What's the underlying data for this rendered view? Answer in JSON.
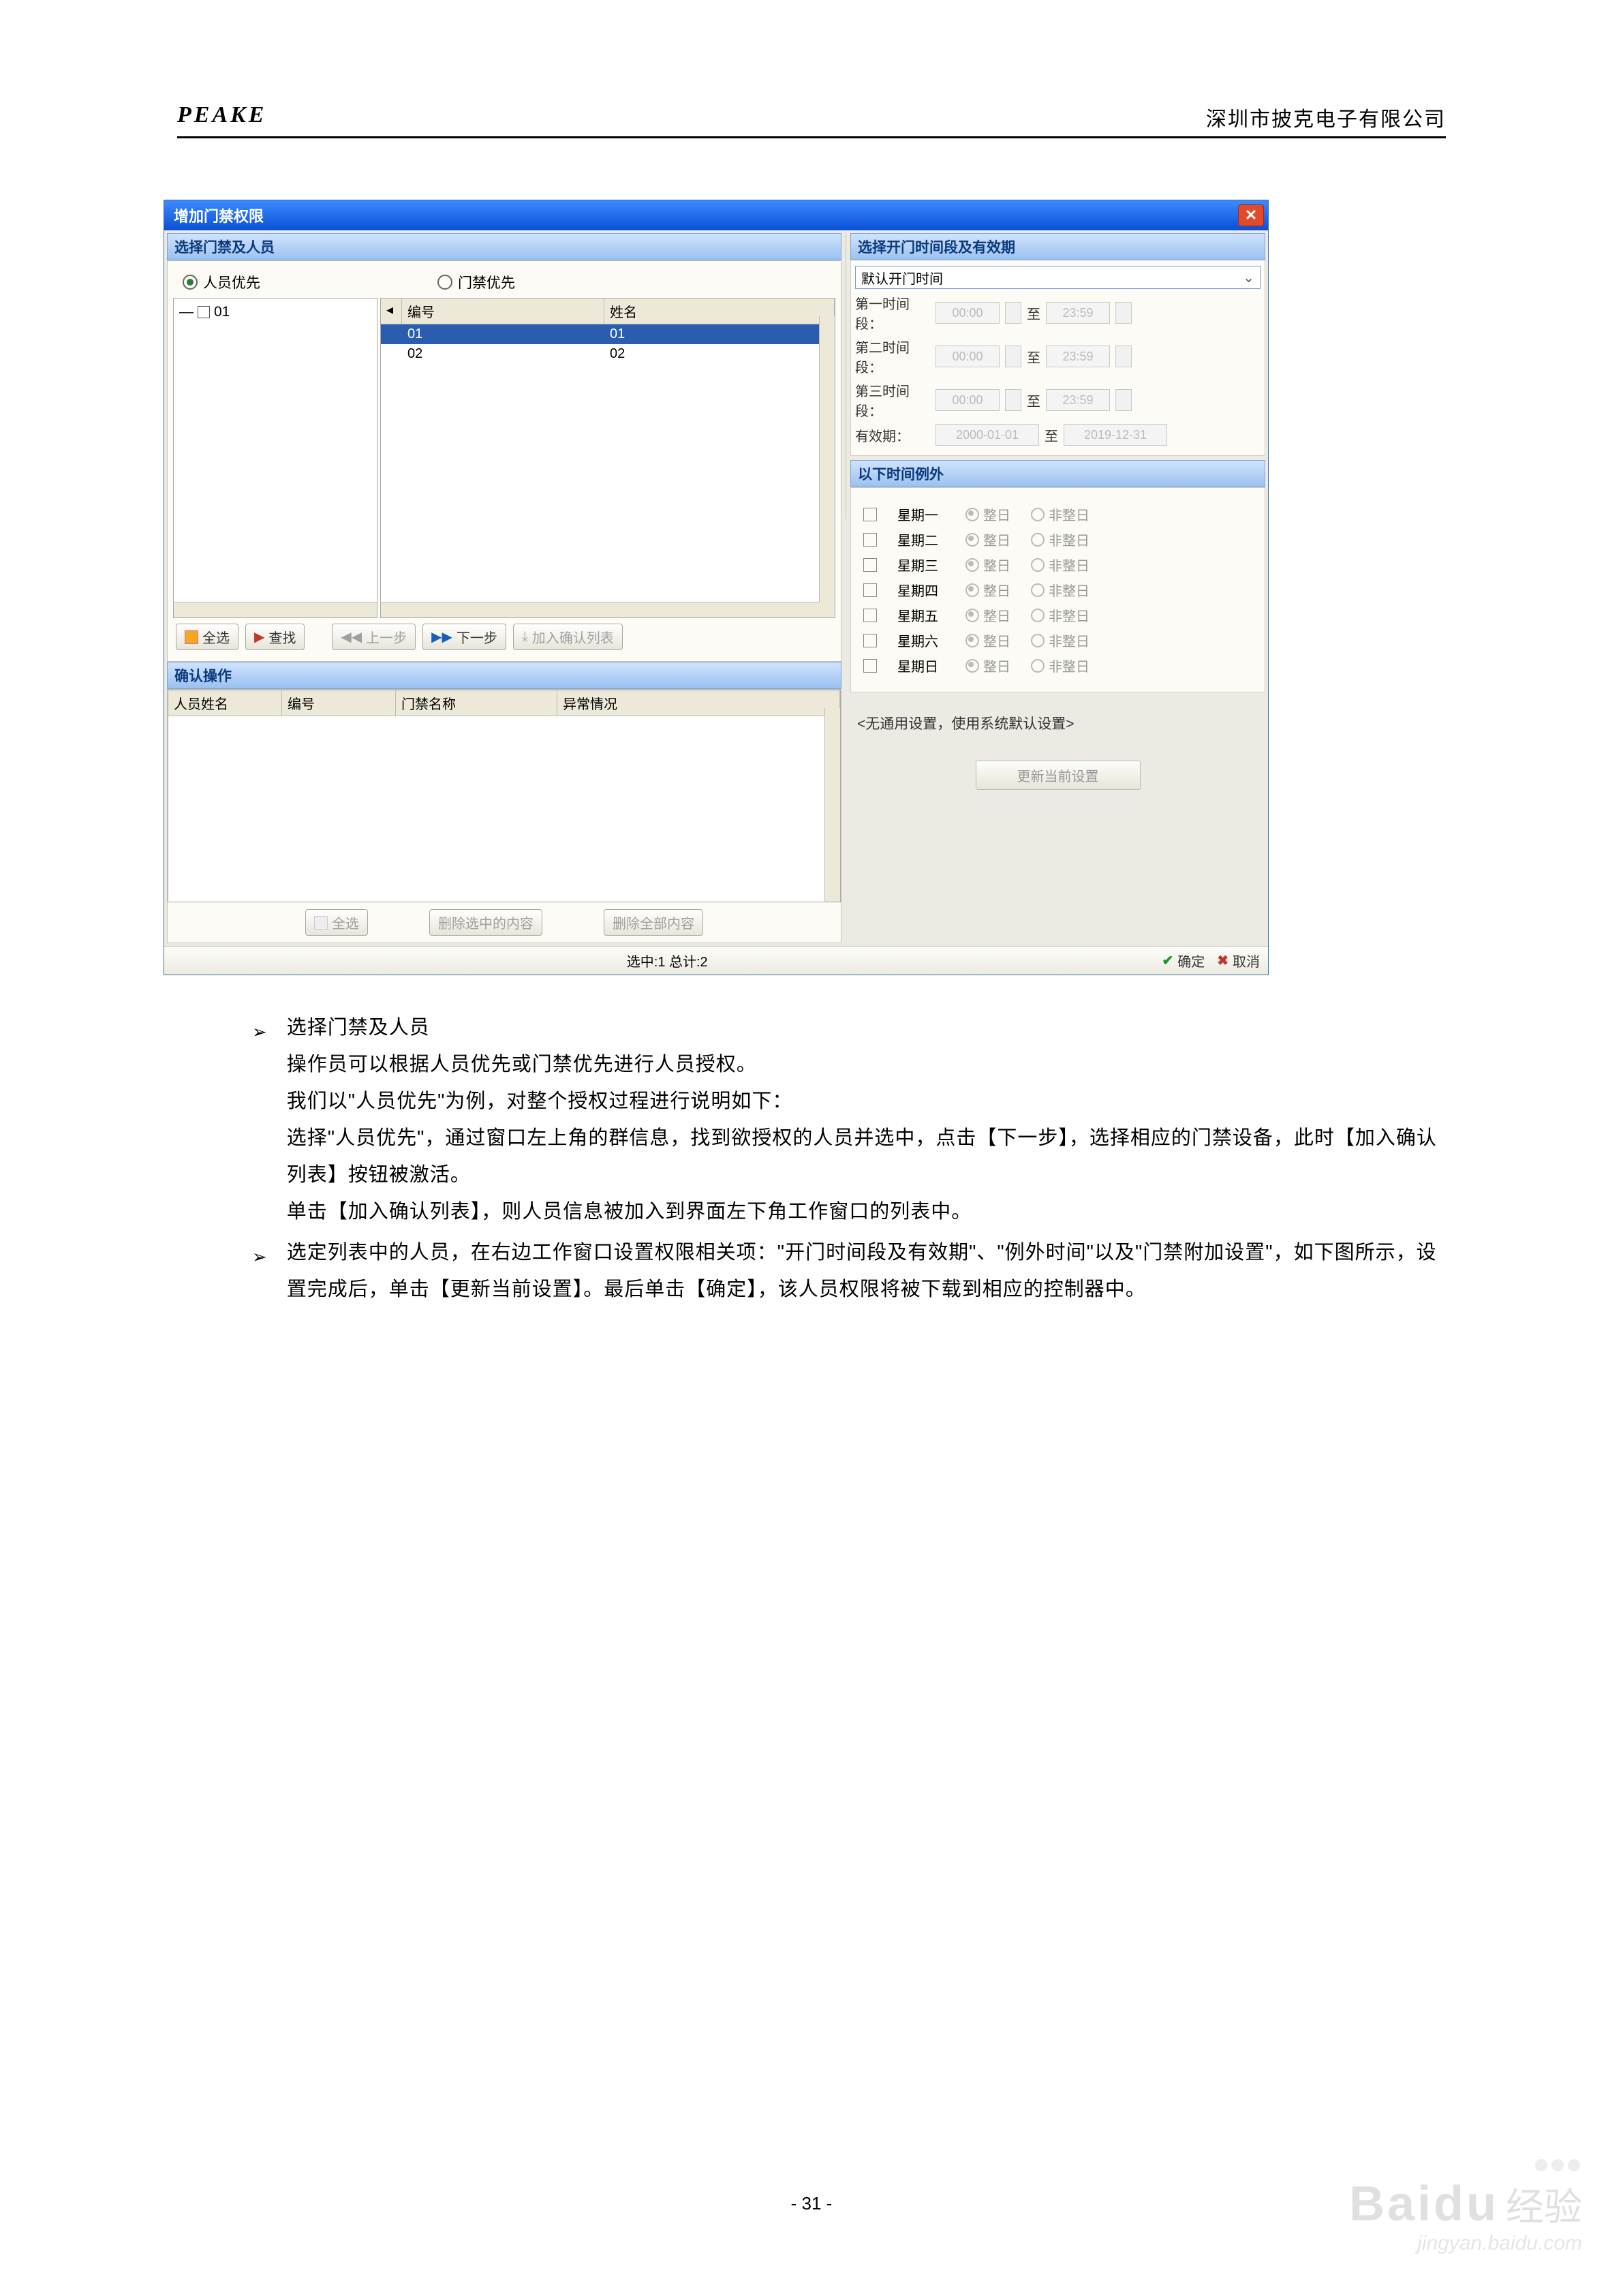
{
  "header": {
    "brand": "PEAKE",
    "company": "深圳市披克电子有限公司"
  },
  "dialog": {
    "title": "增加门禁权限",
    "left_section": "选择门禁及人员",
    "right_section": "选择开门时间段及有效期",
    "radio_person": "人员优先",
    "radio_door": "门禁优先",
    "tree_item": "01",
    "list_cols": {
      "id": "编号",
      "name": "姓名"
    },
    "rows": [
      {
        "id": "01",
        "name": "01"
      },
      {
        "id": "02",
        "name": "02"
      }
    ],
    "btns": {
      "select_all": "全选",
      "search": "查找",
      "prev": "上一步",
      "next": "下一步",
      "add_confirm": "加入确认列表"
    },
    "confirm_section": "确认操作",
    "t2": {
      "a": "人员姓名",
      "b": "编号",
      "c": "门禁名称",
      "d": "异常情况"
    },
    "bottom": {
      "select_all2": "全选",
      "del_sel": "删除选中的内容",
      "del_all": "删除全部内容"
    },
    "time": {
      "default": "默认开门时间",
      "slot1": "第一时间段：",
      "slot2": "第二时间段：",
      "slot3": "第三时间段：",
      "from": "00:00",
      "to_lbl": "至",
      "to": "23:59",
      "valid_lbl": "有效期：",
      "valid_from": "2000-01-01",
      "valid_to": "2019-12-31"
    },
    "except_head": "以下时间例外",
    "days": [
      "星期一",
      "星期二",
      "星期三",
      "星期四",
      "星期五",
      "星期六",
      "星期日"
    ],
    "allday": "整日",
    "notallday": "非整日",
    "sys_msg": "<无通用设置，使用系统默认设置>",
    "update": "更新当前设置",
    "status": "选中:1 总计:2",
    "ok": "确定",
    "cancel": "取消"
  },
  "text": {
    "b1_title": "选择门禁及人员",
    "b1_l1": "操作员可以根据人员优先或门禁优先进行人员授权。",
    "b1_l2": "我们以\"人员优先\"为例，对整个授权过程进行说明如下：",
    "b1_l3": "选择\"人员优先\"，通过窗口左上角的群信息，找到欲授权的人员并选中，点击【下一步】，选择相应的门禁设备，此时【加入确认列表】按钮被激活。",
    "b1_l4": "单击【加入确认列表】，则人员信息被加入到界面左下角工作窗口的列表中。",
    "b2": "选定列表中的人员，在右边工作窗口设置权限相关项：\"开门时间段及有效期\"、\"例外时间\"以及\"门禁附加设置\"，如下图所示，设置完成后，单击【更新当前设置】。最后单击【确定】，该人员权限将被下载到相应的控制器中。"
  },
  "page_number": "- 31 -",
  "watermark": {
    "big": "Bai",
    "du": "du",
    "cn": "经验",
    "url": "jingyan.baidu.com"
  }
}
